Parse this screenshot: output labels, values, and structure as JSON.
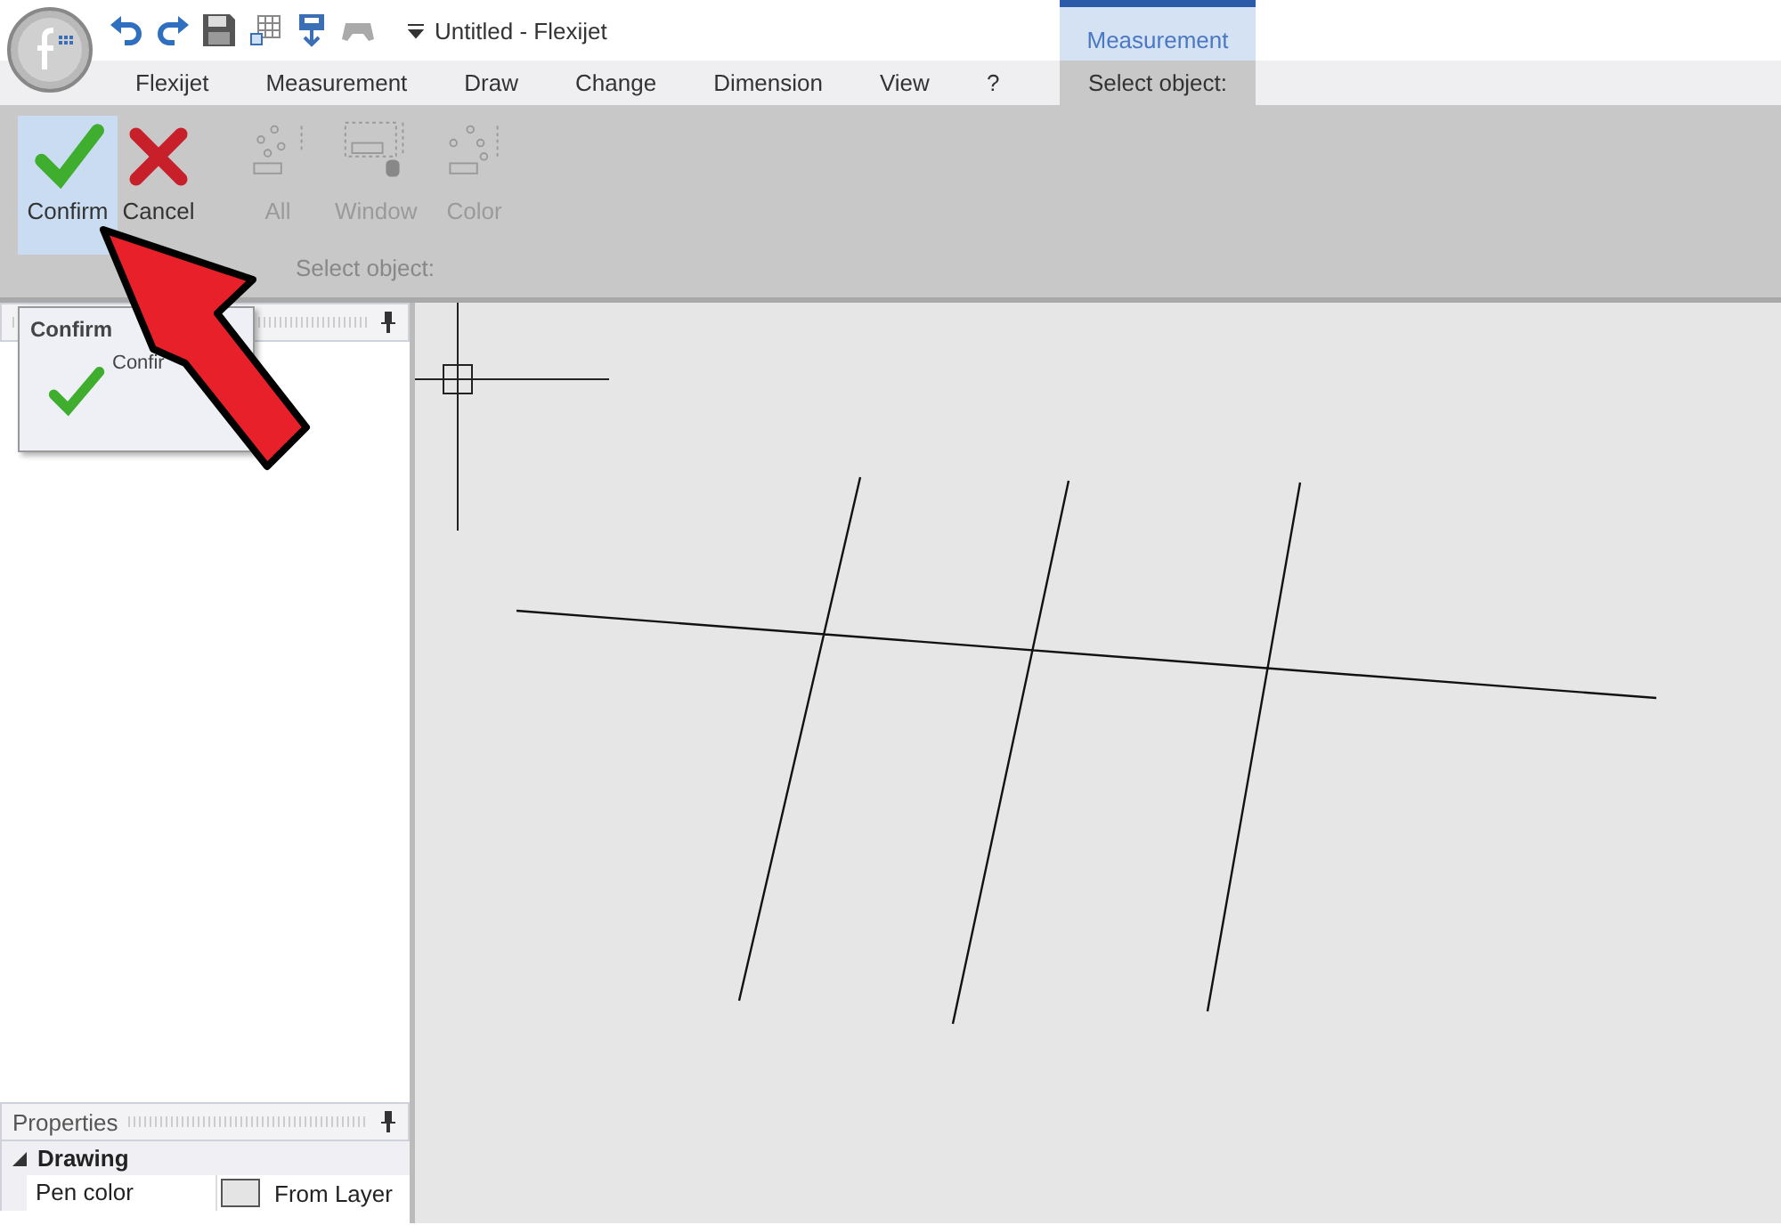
{
  "window": {
    "title": "Untitled -  Flexijet",
    "context_group": "Measurement"
  },
  "tabs": [
    {
      "label": "Flexijet",
      "selected": false
    },
    {
      "label": "Measurement",
      "selected": false
    },
    {
      "label": "Draw",
      "selected": false
    },
    {
      "label": "Change",
      "selected": false
    },
    {
      "label": "Dimension",
      "selected": false
    },
    {
      "label": "View",
      "selected": false
    },
    {
      "label": "?",
      "selected": false
    },
    {
      "label": "Select object:",
      "selected": true
    }
  ],
  "ribbon": {
    "group_label": "Select object:",
    "buttons": [
      {
        "label": "Confirm",
        "kind": "confirm",
        "highlighted": true,
        "disabled": false
      },
      {
        "label": "Cancel",
        "kind": "cancel",
        "highlighted": false,
        "disabled": false
      },
      {
        "label": "All",
        "kind": "all",
        "highlighted": false,
        "disabled": true
      },
      {
        "label": "Window",
        "kind": "window",
        "highlighted": false,
        "disabled": true
      },
      {
        "label": "Color",
        "kind": "color",
        "highlighted": false,
        "disabled": true
      }
    ]
  },
  "tooltip": {
    "title": "Confirm",
    "text": "Confir"
  },
  "properties": {
    "title": "Properties",
    "category": "Drawing",
    "expanded": true,
    "rows": [
      {
        "name": "Pen color",
        "value": "From Layer"
      }
    ]
  }
}
